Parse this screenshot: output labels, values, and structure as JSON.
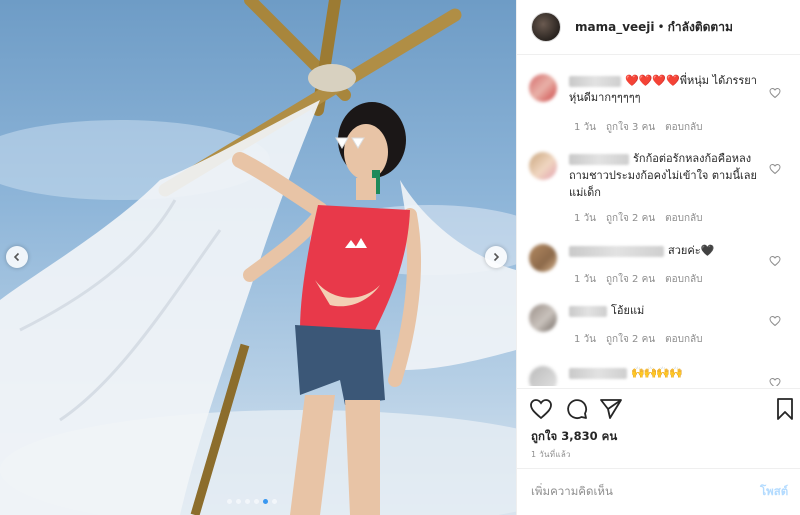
{
  "header": {
    "username": "mama_veeji",
    "separator": "•",
    "follow_status": "กำลังติดตาม"
  },
  "comments": [
    {
      "text": "❤️❤️❤️❤️พี่หนุ่ม ได้ภรรยา หุ่นดีมากๆๆๆๆๆ",
      "time": "1 วัน",
      "likes": "ถูกใจ 3 คน",
      "reply": "ตอบกลับ"
    },
    {
      "text": "รักก้อต่อรักหลงก้อคือหลงถามชาวประมงก้อคงไม่เข้าใจ ตามนี้เลยแม่เด็ก",
      "time": "1 วัน",
      "likes": "ถูกใจ 2 คน",
      "reply": "ตอบกลับ"
    },
    {
      "text": "สวยค่ะ🖤",
      "time": "1 วัน",
      "likes": "ถูกใจ 2 คน",
      "reply": "ตอบกลับ"
    },
    {
      "text": "โอ้ยแม่",
      "time": "1 วัน",
      "likes": "ถูกใจ 2 คน",
      "reply": "ตอบกลับ"
    },
    {
      "text": "🙌🙌🙌🙌"
    }
  ],
  "footer": {
    "likes_count": "ถูกใจ 3,830 คน",
    "time_ago": "1 วันที่แล้ว",
    "add_comment_placeholder": "เพิ่มความคิดเห็น",
    "post_label": "โพสต์"
  },
  "carousel": {
    "slide_count": 6,
    "active_index": 4
  },
  "icons": {
    "prev": "chevron-left-icon",
    "next": "chevron-right-icon",
    "like": "heart-icon",
    "comment": "comment-icon",
    "share": "paper-plane-icon",
    "save": "bookmark-icon"
  },
  "colors": {
    "accent": "#3897f0",
    "post_button": "#b3dbff",
    "muted": "#8e8e8e"
  }
}
